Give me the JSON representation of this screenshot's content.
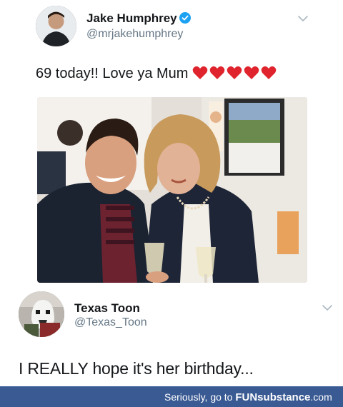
{
  "tweet_1": {
    "author_name": "Jake Humphrey",
    "author_handle": "@mrjakehumphrey",
    "text": "69 today!! Love ya Mum",
    "hearts": [
      "heart-icon",
      "heart-icon",
      "heart-icon",
      "heart-icon",
      "heart-icon"
    ],
    "heart_color": "#e0242e",
    "verified_color": "#1da1f2"
  },
  "tweet_2": {
    "author_name": "Texas Toon",
    "author_handle": "@Texas_Toon",
    "text": "I REALLY hope it's her birthday..."
  },
  "footer": {
    "prefix": "Seriously, go to ",
    "brand_bold": "FUNsubstance",
    "brand_suffix": ".com",
    "background": "#3a5a93"
  }
}
